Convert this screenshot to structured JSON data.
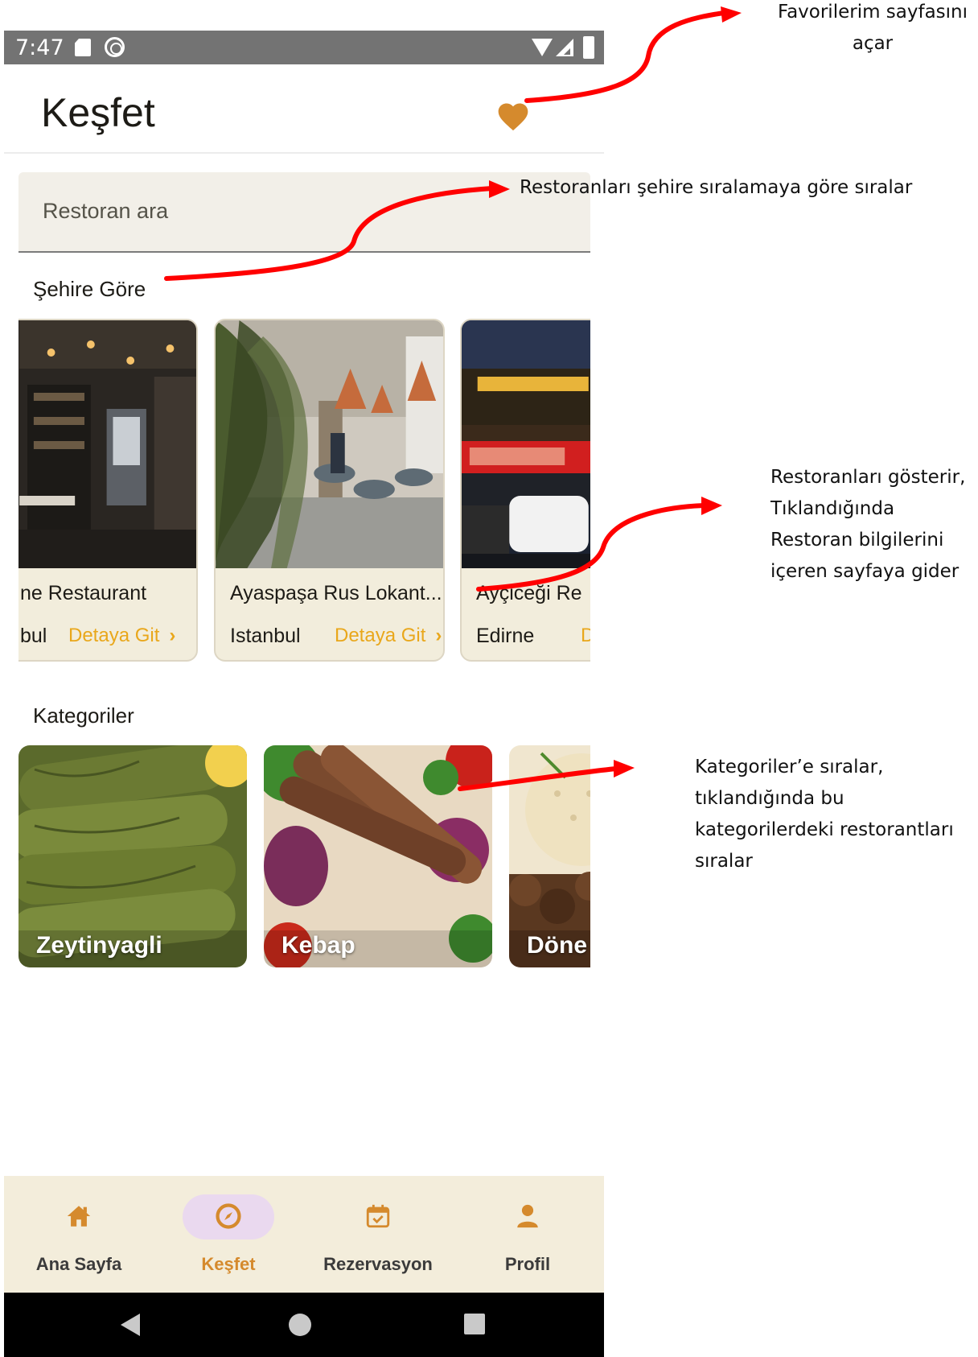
{
  "status_bar": {
    "time": "7:47"
  },
  "header": {
    "title": "Keşfet"
  },
  "search": {
    "placeholder": "Restoran ara"
  },
  "sections": {
    "by_city": "Şehire Göre",
    "categories": "Kategoriler"
  },
  "restaurants": [
    {
      "name": "ne Restaurant",
      "city": "bul",
      "link": "Detaya Git"
    },
    {
      "name": "Ayaspaşa Rus Lokant...",
      "city": "Istanbul",
      "link": "Detaya Git"
    },
    {
      "name": "Ayçiceği Re",
      "city": "Edirne",
      "link": "Detaya Git"
    }
  ],
  "categories": [
    {
      "label": "Zeytinyagli"
    },
    {
      "label": "Kebap"
    },
    {
      "label": "Döne"
    }
  ],
  "bottom_nav": {
    "items": [
      {
        "label": "Ana Sayfa",
        "icon": "home-icon"
      },
      {
        "label": "Keşfet",
        "icon": "compass-icon",
        "active": true
      },
      {
        "label": "Rezervasyon",
        "icon": "calendar-check-icon"
      },
      {
        "label": "Profil",
        "icon": "person-icon"
      }
    ]
  },
  "annotations": {
    "favorites": "Favorilerim sayfasını açar",
    "city_sort": "Restoranları şehire sıralamaya göre sıralar",
    "cards": "Restoranları gösterir, Tıklandığında Restoran bilgilerini içeren sayfaya gider",
    "categories": "Kategoriler’e sıralar, tıklandığında bu kategorilerdeki restorantları sıralar"
  },
  "colors": {
    "accent": "#D58A2D",
    "link": "#E9A71B",
    "card_background": "#F2EDDC",
    "nav_background": "#F3EDDB",
    "active_indicator": "#EAD9EF",
    "annotation_arrow": "#FF0000"
  }
}
